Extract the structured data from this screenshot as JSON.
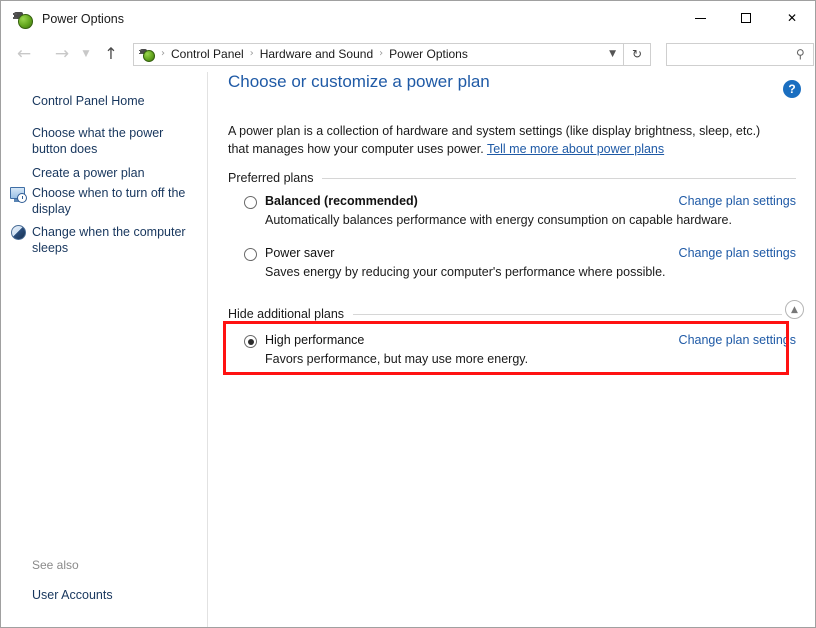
{
  "window": {
    "title": "Power Options",
    "icon": "power-plug-icon",
    "minimize_label": "Minimize",
    "maximize_label": "Maximize",
    "close_label": "Close"
  },
  "nav": {
    "back_label": "Back",
    "forward_label": "Forward",
    "recent_label": "Recent locations",
    "up_label": "Up one level",
    "refresh_label": "Refresh",
    "dropdown_label": "Previous locations"
  },
  "breadcrumb": {
    "separator": "›",
    "items": [
      {
        "label": "Control Panel"
      },
      {
        "label": "Hardware and Sound"
      },
      {
        "label": "Power Options"
      }
    ]
  },
  "search": {
    "value": "",
    "placeholder": "",
    "icon": "search-icon"
  },
  "sidebar": {
    "items": [
      {
        "label": "Control Panel Home",
        "icon": ""
      },
      {
        "label": "Choose what the power button does",
        "icon": ""
      },
      {
        "label": "Create a power plan",
        "icon": ""
      },
      {
        "label": "Choose when to turn off the display",
        "icon": "monitor-clock-icon"
      },
      {
        "label": "Change when the computer sleeps",
        "icon": "moon-icon"
      }
    ],
    "see_also_label": "See also",
    "see_also_items": [
      {
        "label": "User Accounts"
      }
    ]
  },
  "main": {
    "help_label": "?",
    "title": "Choose or customize a power plan",
    "description": "A power plan is a collection of hardware and system settings (like display brightness, sleep, etc.) that manages how your computer uses power. ",
    "description_link": "Tell me more about power plans",
    "preferred_section": {
      "label": "Preferred plans",
      "plans": [
        {
          "name": "Balanced (recommended)",
          "description": "Automatically balances performance with energy consumption on capable hardware.",
          "selected": false,
          "bold": true,
          "action_label": "Change plan settings"
        },
        {
          "name": "Power saver",
          "description": "Saves energy by reducing your computer's performance where possible.",
          "selected": false,
          "bold": false,
          "action_label": "Change plan settings"
        }
      ]
    },
    "additional_section": {
      "label": "Hide additional plans",
      "collapse_icon": "chevron-up-icon",
      "plans": [
        {
          "name": "High performance",
          "description": "Favors performance, but may use more energy.",
          "selected": true,
          "bold": false,
          "action_label": "Change plan settings"
        }
      ]
    }
  },
  "annotation": {
    "color": "#ff1111",
    "target": "high-performance-plan-row"
  }
}
